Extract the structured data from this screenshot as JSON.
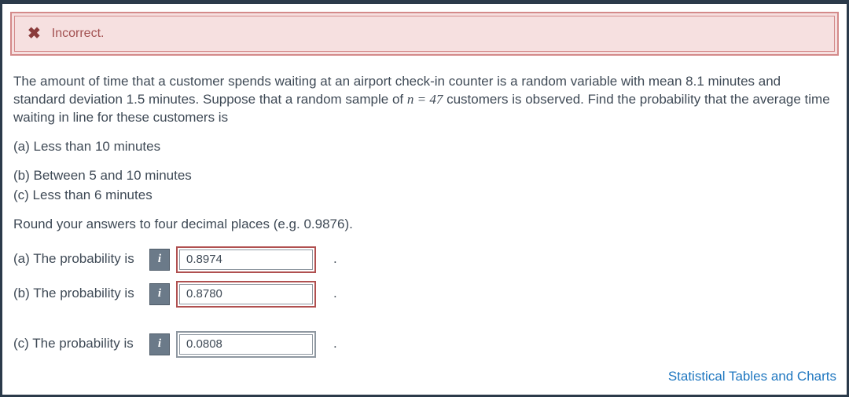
{
  "alert": {
    "status": "Incorrect."
  },
  "problem": {
    "text_before_n": "The amount of time that a customer spends waiting at an airport check-in counter is a random variable with mean 8.1 minutes and standard deviation 1.5 minutes. Suppose that a random sample of ",
    "n_expr": "n = 47",
    "text_after_n": " customers is observed. Find the probability that the average time waiting in line for these customers is"
  },
  "parts": {
    "a": "(a) Less than 10 minutes",
    "b": "(b) Between 5 and 10 minutes",
    "c": "(c) Less than 6 minutes"
  },
  "round_note": "Round your answers to four decimal places (e.g. 0.9876).",
  "answers": {
    "a": {
      "label": "(a) The probability is",
      "value": "0.8974"
    },
    "b": {
      "label": "(b) The probability is",
      "value": "0.8780"
    },
    "c": {
      "label": "(c) The probability is",
      "value": "0.0808"
    }
  },
  "link": "Statistical Tables and Charts",
  "icons": {
    "info": "i"
  }
}
